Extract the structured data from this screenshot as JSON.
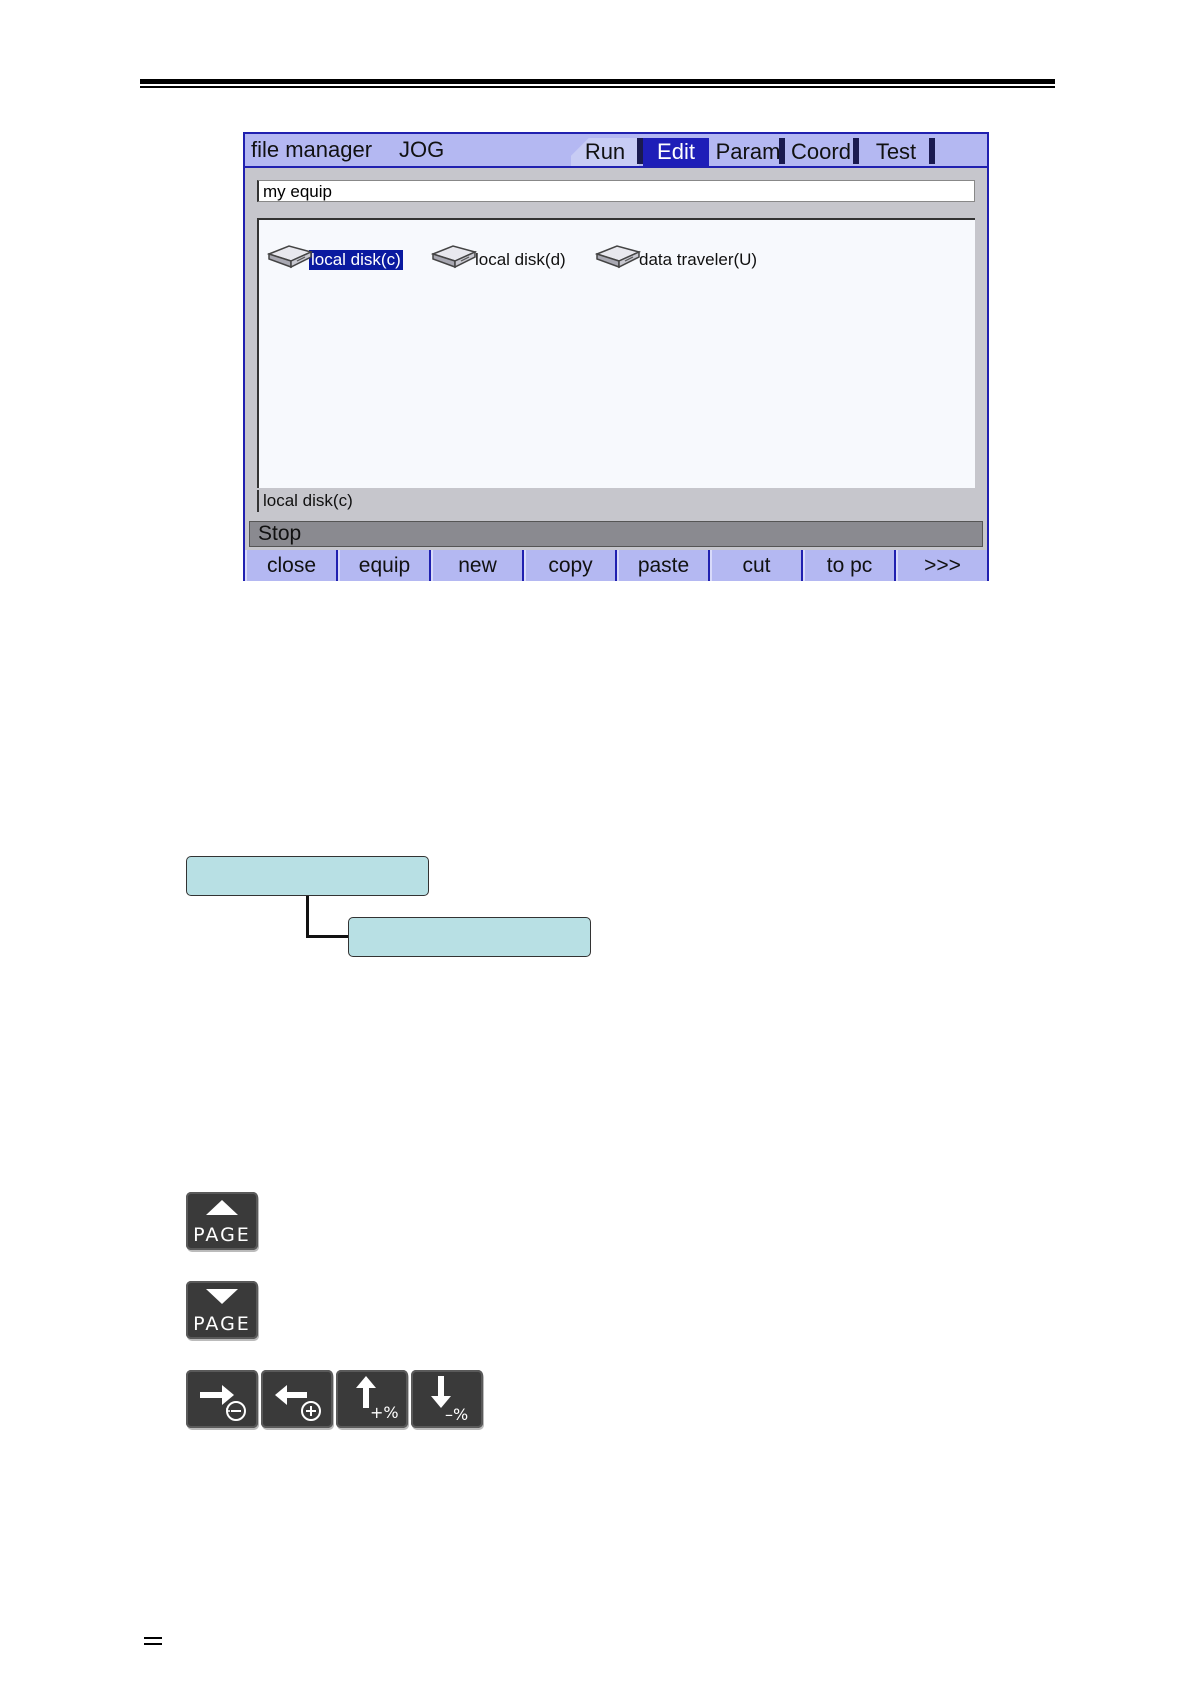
{
  "window": {
    "title": "file manager",
    "mode": "JOG",
    "tabs": [
      {
        "label": "Run"
      },
      {
        "label": "Edit",
        "active": true
      },
      {
        "label": "Param"
      },
      {
        "label": "Coord"
      },
      {
        "label": "Test"
      }
    ],
    "path": "my equip",
    "files": [
      {
        "label": "local disk(c)",
        "icon": "disk-icon",
        "selected": true
      },
      {
        "label": "local disk(d)",
        "icon": "disk-icon"
      },
      {
        "label": "data traveler(U)",
        "icon": "usb-drive-icon"
      }
    ],
    "status_selected": "local disk(c)",
    "run_state": "Stop",
    "softkeys": [
      "close",
      "equip",
      "new",
      "copy",
      "paste",
      "cut",
      "to pc",
      ">>>"
    ]
  },
  "keys": {
    "page_up": {
      "label": "PAGE",
      "icon": "arrow-up-icon"
    },
    "page_down": {
      "label": "PAGE",
      "icon": "arrow-down-icon"
    },
    "row": [
      {
        "icon": "arrow-right-minus-icon"
      },
      {
        "icon": "arrow-left-plus-icon"
      },
      {
        "icon": "arrow-up-percent-plus-icon"
      },
      {
        "icon": "arrow-down-percent-minus-icon"
      }
    ]
  },
  "colors": {
    "title_bar": "#b4b8f2",
    "active_tab": "#1e1eb8",
    "selection": "#0a1aa0",
    "tree_box": "#b8e0e4",
    "key_face": "#3a3a3a"
  }
}
